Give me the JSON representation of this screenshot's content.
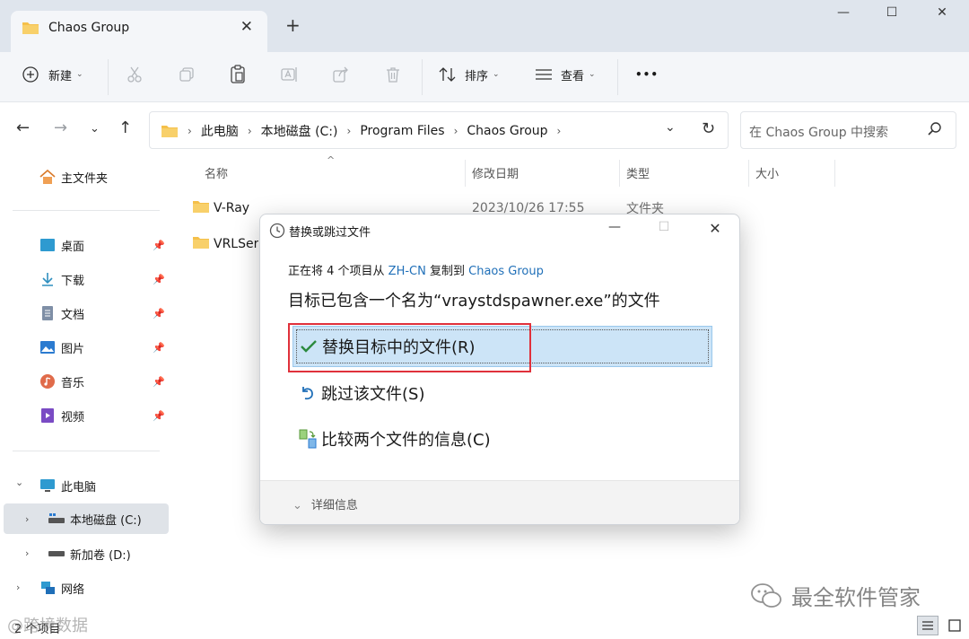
{
  "window": {
    "tab_title": "Chaos Group",
    "tab_close": "✕",
    "new_tab": "+",
    "minimize": "—",
    "maximize": "☐",
    "close": "✕"
  },
  "toolbar": {
    "new_label": "新建",
    "sort_label": "排序",
    "view_label": "查看",
    "more": "•••"
  },
  "address": {
    "crumbs": [
      "此电脑",
      "本地磁盘 (C:)",
      "Program Files",
      "Chaos Group"
    ],
    "search_placeholder": "在 Chaos Group 中搜索"
  },
  "sidebar": {
    "home": "主文件夹",
    "quick": [
      {
        "label": "桌面",
        "icon": "desktop-icon"
      },
      {
        "label": "下载",
        "icon": "download-icon"
      },
      {
        "label": "文档",
        "icon": "document-icon"
      },
      {
        "label": "图片",
        "icon": "pictures-icon"
      },
      {
        "label": "音乐",
        "icon": "music-icon"
      },
      {
        "label": "视频",
        "icon": "video-icon"
      }
    ],
    "this_pc": "此电脑",
    "drive_c": "本地磁盘 (C:)",
    "drive_d": "新加卷 (D:)",
    "network": "网络"
  },
  "filelist": {
    "columns": {
      "name": "名称",
      "modified": "修改日期",
      "type": "类型",
      "size": "大小"
    },
    "rows": [
      {
        "name": "V-Ray",
        "modified": "2023/10/26 17:55",
        "type": "文件夹"
      },
      {
        "name": "VRLSer",
        "modified": "",
        "type": ""
      }
    ]
  },
  "status": {
    "count": "2 个项目",
    "watermark": "最全软件管家",
    "watermark_left": "@跨境数据"
  },
  "dialog": {
    "title": "替换或跳过文件",
    "info_prefix": "正在将 4 个项目从 ",
    "source": "ZH-CN",
    "info_mid": " 复制到 ",
    "dest": "Chaos Group",
    "headline": "目标已包含一个名为“vraystdspawner.exe”的文件",
    "replace": "替换目标中的文件(R)",
    "skip": "跳过该文件(S)",
    "compare": "比较两个文件的信息(C)",
    "more_details": "详细信息"
  },
  "colors": {
    "accent": "#1f6fb8",
    "folder": "#f5c04a",
    "selection": "#cce4f7",
    "highlight_box": "#e0313b",
    "check": "#2b8a3e"
  }
}
